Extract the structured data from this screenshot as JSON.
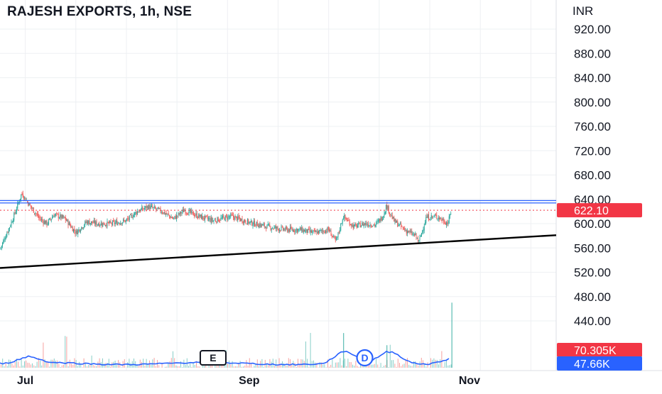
{
  "header": {
    "title": "RAJESH EXPORTS, 1h, NSE",
    "currency": "INR"
  },
  "colors": {
    "up": "#26a69a",
    "down": "#ef5350",
    "resistance": "#2962ff",
    "support": "#000000",
    "price_tag": "#f23645",
    "volume_ma": "#2962ff",
    "grid": "#eef0f3",
    "marker_d": "#2962ff"
  },
  "chart_data": {
    "type": "candlestick",
    "title": "RAJESH EXPORTS, 1h, NSE",
    "ylabel": "INR",
    "ylim": [
      507,
      930
    ],
    "y_ticks": [
      920,
      880,
      840,
      800,
      760,
      720,
      680,
      640,
      600,
      560,
      520,
      480,
      440
    ],
    "x_ticks": [
      "Jul",
      "Sep",
      "Nov"
    ],
    "x_range": [
      "2023-06-24",
      "2023-11-25"
    ],
    "x_tick_dates": [
      "2023-07-01",
      "2023-09-01",
      "2023-11-01"
    ],
    "last_price": "622.10",
    "volume_value": "70.305K",
    "volume_ma_value": "47.66K",
    "resistance_lines": [
      638,
      634
    ],
    "dotted_price_line": 622.1,
    "support_line": {
      "start": [
        "2023-06-24",
        527
      ],
      "end": [
        "2023-11-25",
        581
      ]
    },
    "price_path": [
      [
        "2023-06-24",
        558
      ],
      [
        "2023-06-27",
        600
      ],
      [
        "2023-06-28",
        615
      ],
      [
        "2023-06-30",
        650
      ],
      [
        "2023-07-02",
        632
      ],
      [
        "2023-07-05",
        608
      ],
      [
        "2023-07-07",
        600
      ],
      [
        "2023-07-09",
        615
      ],
      [
        "2023-07-12",
        608
      ],
      [
        "2023-07-15",
        585
      ],
      [
        "2023-07-18",
        603
      ],
      [
        "2023-07-21",
        600
      ],
      [
        "2023-07-25",
        600
      ],
      [
        "2023-07-29",
        605
      ],
      [
        "2023-08-01",
        620
      ],
      [
        "2023-08-04",
        628
      ],
      [
        "2023-08-08",
        620
      ],
      [
        "2023-08-11",
        608
      ],
      [
        "2023-08-14",
        622
      ],
      [
        "2023-08-18",
        612
      ],
      [
        "2023-08-22",
        605
      ],
      [
        "2023-08-27",
        612
      ],
      [
        "2023-09-01",
        602
      ],
      [
        "2023-09-06",
        595
      ],
      [
        "2023-09-11",
        590
      ],
      [
        "2023-09-15",
        590
      ],
      [
        "2023-09-19",
        585
      ],
      [
        "2023-09-23",
        590
      ],
      [
        "2023-09-25",
        570
      ],
      [
        "2023-09-26",
        590
      ],
      [
        "2023-09-27",
        612
      ],
      [
        "2023-09-30",
        595
      ],
      [
        "2023-10-03",
        600
      ],
      [
        "2023-10-06",
        598
      ],
      [
        "2023-10-08",
        612
      ],
      [
        "2023-10-09",
        630
      ],
      [
        "2023-10-11",
        605
      ],
      [
        "2023-10-14",
        590
      ],
      [
        "2023-10-17",
        580
      ],
      [
        "2023-10-18",
        570
      ],
      [
        "2023-10-20",
        610
      ],
      [
        "2023-10-23",
        612
      ],
      [
        "2023-10-26",
        600
      ],
      [
        "2023-10-27",
        622
      ]
    ],
    "volume_spikes": [
      [
        "2023-09-27",
        420
      ],
      [
        "2023-09-28",
        290
      ],
      [
        "2023-10-09",
        400
      ],
      [
        "2023-10-11",
        210
      ],
      [
        "2023-10-27",
        470
      ],
      [
        "2023-07-02",
        260
      ]
    ],
    "markers": [
      {
        "label": "E",
        "date": "2023-08-22"
      },
      {
        "label": "D",
        "date": "2023-10-03"
      }
    ]
  }
}
